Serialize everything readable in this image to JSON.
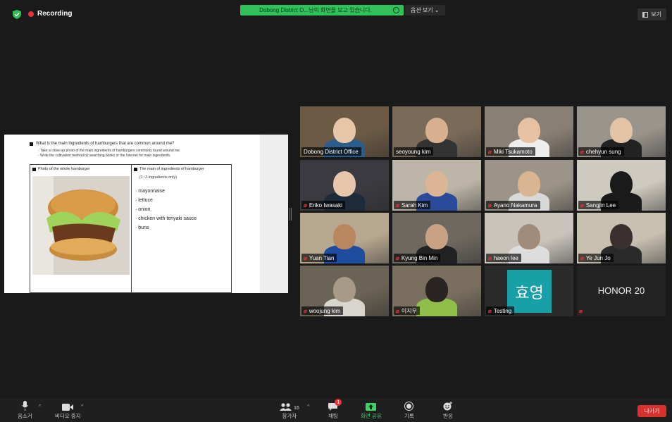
{
  "recording": {
    "label": "Recording"
  },
  "share_banner": {
    "text": "Dobong District O...님의 화면을 보고 있습니다.",
    "options_label": "옵션 보기 ⌄"
  },
  "view_button": {
    "label": "보기"
  },
  "document": {
    "question": "What is the main ingredients of hamburgers that are common around me?",
    "instructions": [
      "◦ Take a close-up photo of the main ingredients of hamburgers commonly found around me.",
      "◦ Write the cultivation method by searching books or the Internet for main ingredients."
    ],
    "col_photo_header": "Photo of the whole hamburger",
    "col_ingredients_header": "The main of ingredients of hamburger",
    "ingredients_note": "(1~2 ingredients only)",
    "ingredients": [
      "· mayonnaise",
      "· lettuce",
      "· onion",
      "· chicken  with  teriyaki  sauce",
      "· buns"
    ]
  },
  "participants": [
    {
      "name": "Dobong District Office",
      "muted": false,
      "active": true
    },
    {
      "name": "seoyoung kim",
      "muted": false
    },
    {
      "name": "Miki Tsukamoto",
      "muted": true
    },
    {
      "name": "chehyun sung",
      "muted": true
    },
    {
      "name": "Eriko Iwasaki",
      "muted": true
    },
    {
      "name": "Sarah Kim",
      "muted": true
    },
    {
      "name": "Ayano Nakamura",
      "muted": true
    },
    {
      "name": "Sangjin Lee",
      "muted": true
    },
    {
      "name": "Yuan Tian",
      "muted": true
    },
    {
      "name": "Kyung Bin Min",
      "muted": true
    },
    {
      "name": "haeon lee",
      "muted": true
    },
    {
      "name": "Ye Jun Jo",
      "muted": true
    },
    {
      "name": "woojung kim",
      "muted": true
    },
    {
      "name": "이지우",
      "muted": true
    },
    {
      "name": "Testing",
      "muted": true,
      "avatar_text": "효영"
    },
    {
      "name": "HONOR 20",
      "muted": true,
      "video_off": true
    }
  ],
  "toolbar": {
    "mute_label": "음소거",
    "video_label": "비디오 중지",
    "participants_label": "참가자",
    "participants_count": "16",
    "chat_label": "채팅",
    "chat_badge": "1",
    "share_label": "화면 공유",
    "record_label": "기록",
    "reactions_label": "반응",
    "leave_label": "나가기"
  },
  "colors": {
    "accent_green": "#31c15a",
    "recording_red": "#e8323c",
    "leave_red": "#d9312c",
    "active_speaker": "#e0dd5a",
    "avatar_teal": "#17a0a8"
  }
}
